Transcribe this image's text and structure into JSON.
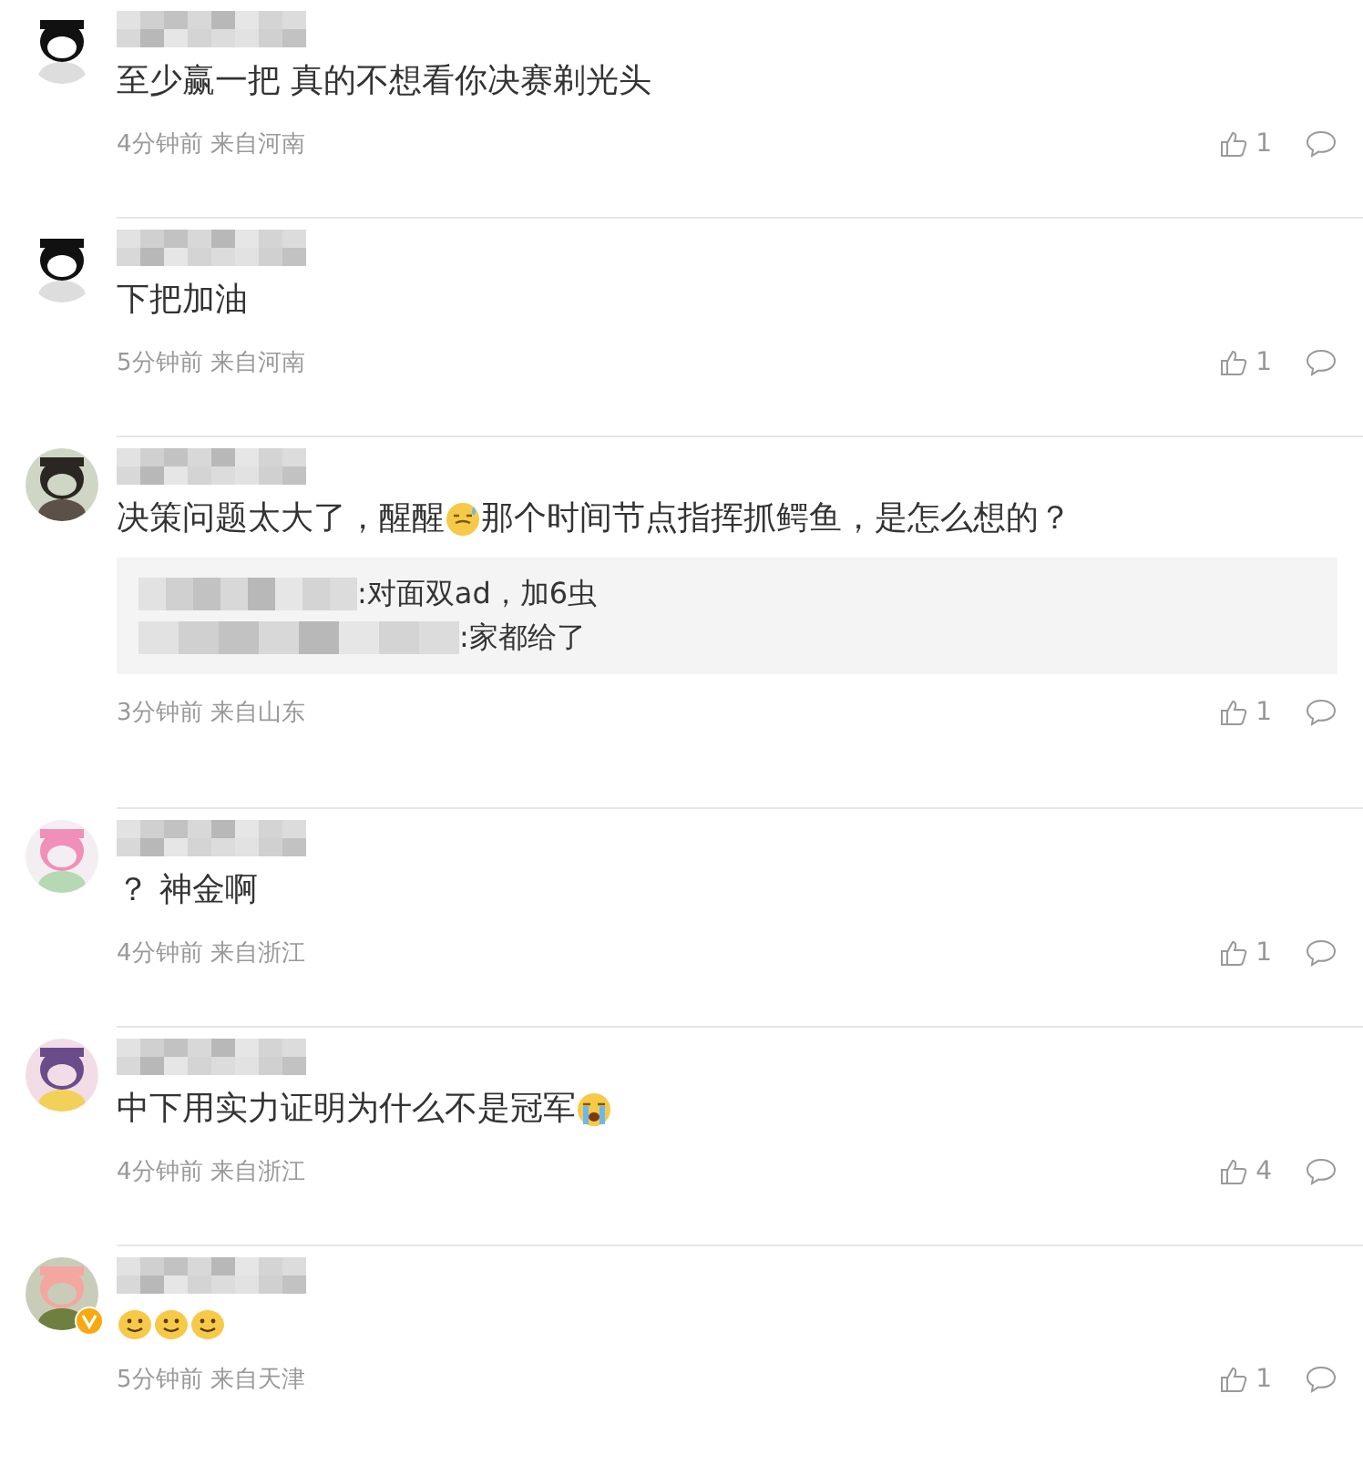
{
  "comments": [
    {
      "verified": false,
      "content": [
        {
          "kind": "text",
          "text": "至少赢一把 真的不想看你决赛剃光头"
        }
      ],
      "meta": "4分钟前 来自河南",
      "likes": "1"
    },
    {
      "verified": false,
      "content": [
        {
          "kind": "text",
          "text": "下把加油"
        }
      ],
      "meta": "5分钟前 来自河南",
      "likes": "1"
    },
    {
      "verified": false,
      "content": [
        {
          "kind": "text",
          "text": "决策问题太大了，醒醒"
        },
        {
          "kind": "sweat"
        },
        {
          "kind": "text",
          "text": "那个时间节点指挥抓鳄鱼，是怎么想的？"
        }
      ],
      "replies": [
        ":对面双ad，加6虫",
        ":家都给了"
      ],
      "meta": "3分钟前 来自山东",
      "likes": "1"
    },
    {
      "verified": false,
      "content": [
        {
          "kind": "text",
          "text": "？ 神金啊"
        }
      ],
      "meta": "4分钟前 来自浙江",
      "likes": "1"
    },
    {
      "verified": false,
      "content": [
        {
          "kind": "text",
          "text": "中下用实力证明为什么不是冠军"
        },
        {
          "kind": "cry"
        }
      ],
      "meta": "4分钟前 来自浙江",
      "likes": "4"
    },
    {
      "verified": true,
      "content": [
        {
          "kind": "smile"
        },
        {
          "kind": "smile"
        },
        {
          "kind": "smile"
        }
      ],
      "meta": "5分钟前 来自天津",
      "likes": "1"
    }
  ]
}
